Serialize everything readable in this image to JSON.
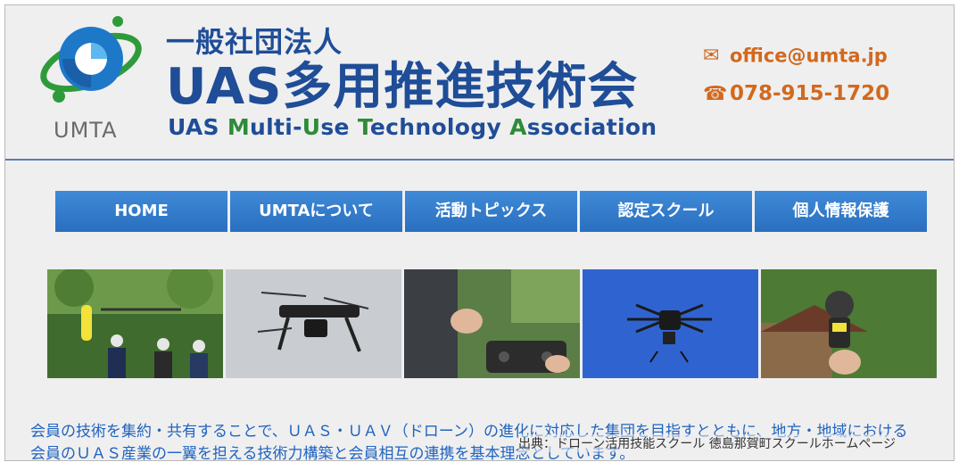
{
  "header": {
    "logo_text": "UMTA",
    "org_type": "一般社団法人",
    "org_name": "UAS多用推進技術会",
    "org_en_parts": [
      {
        "text": "U",
        "green": false
      },
      {
        "text": "AS ",
        "green": false
      },
      {
        "text": "M",
        "green": true
      },
      {
        "text": "ulti-",
        "green": false
      },
      {
        "text": "U",
        "green": true
      },
      {
        "text": "se ",
        "green": false
      },
      {
        "text": "T",
        "green": true
      },
      {
        "text": "echnology ",
        "green": false
      },
      {
        "text": "A",
        "green": true
      },
      {
        "text": "ssociation",
        "green": false
      }
    ],
    "email": "office@umta.jp",
    "phone": "078-915-1720",
    "email_icon": "mail-icon",
    "phone_icon": "phone-icon"
  },
  "nav": {
    "items": [
      {
        "label": "HOME"
      },
      {
        "label": "UMTAについて"
      },
      {
        "label": "活動トピックス"
      },
      {
        "label": "認定スクール"
      },
      {
        "label": "個人情報保護"
      }
    ]
  },
  "photos": [
    {
      "name": "drone-rescue-team-photo"
    },
    {
      "name": "drone-gray-sky-photo"
    },
    {
      "name": "drone-controller-operator-photo"
    },
    {
      "name": "hexacopter-blue-sky-photo"
    },
    {
      "name": "anemometer-hand-photo"
    }
  ],
  "description": {
    "line1": "会員の技術を集約・共有することで、ＵＡＳ・ＵＡＶ（ドローン）の進化に対応した集団を目指すとともに、地方・地域における",
    "line2": "会員のＵＡＳ産業の一翼を担える技術力構築と会員相互の連携を基本理念としています。"
  },
  "caption": "出典：ドローン活用技能スクール 徳島那賀町スクールホームページ",
  "colors": {
    "brand_blue": "#1f4d97",
    "brand_green": "#2e8b3a",
    "contact_orange": "#d2691e",
    "nav_blue": "#2a6fbf",
    "text_blue": "#1f63c0"
  }
}
